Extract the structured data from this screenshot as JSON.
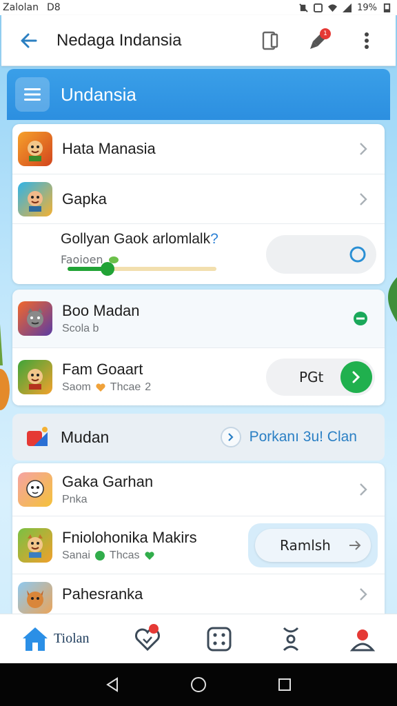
{
  "status_bar": {
    "carrier": "Zalolan",
    "network": "D8",
    "battery": "19%"
  },
  "app_bar": {
    "title": "Nedaga Indansia",
    "icons": [
      "back-arrow-icon",
      "tablet-icon",
      "rocket-icon",
      "more-vert-icon"
    ],
    "notification_count": "1"
  },
  "section": {
    "title": "Undansia",
    "icon": "menu-icon",
    "accent": "#2c8fe0"
  },
  "card_a": {
    "items": [
      {
        "title": "Hata Manasia",
        "icon": "character-avatar-icon"
      },
      {
        "title": "Gapka",
        "icon": "character-avatar-icon"
      }
    ],
    "progress": {
      "question_text": "Gollyan Gaok arlomlalk",
      "question_mark": "?",
      "label": "Faoioen",
      "value_fraction": 0.27
    }
  },
  "card_b": {
    "items": [
      {
        "title": "Boo Madan",
        "subtitle": "Scola b",
        "action": "minus-circle-icon"
      },
      {
        "title": "Fam Goaart",
        "subtitle_a": "Saom",
        "subtitle_b": "Thcae",
        "subtitle_c": "2",
        "button_label": "PGt"
      }
    ]
  },
  "mudan": {
    "title": "Mudan",
    "link_label": "Porkanı 3u! Clan",
    "icon": "app-logo-icon"
  },
  "card_c": {
    "items": [
      {
        "title": "Gaka Garhan",
        "subtitle": "Pnka"
      },
      {
        "title": "Fniolohonika Makirs",
        "subtitle_a": "Sanai",
        "subtitle_b": "Thcas",
        "button_label": "Ramlsh"
      },
      {
        "title": "Pahesranka"
      }
    ]
  },
  "bottom_nav": {
    "home_label": "Tiolan",
    "icons": [
      "home-icon",
      "heart-message-icon",
      "dice-icon",
      "people-icon",
      "profile-icon"
    ]
  },
  "colors": {
    "green": "#20b04e",
    "link_blue": "#2a7fc4",
    "badge_red": "#e53935"
  }
}
